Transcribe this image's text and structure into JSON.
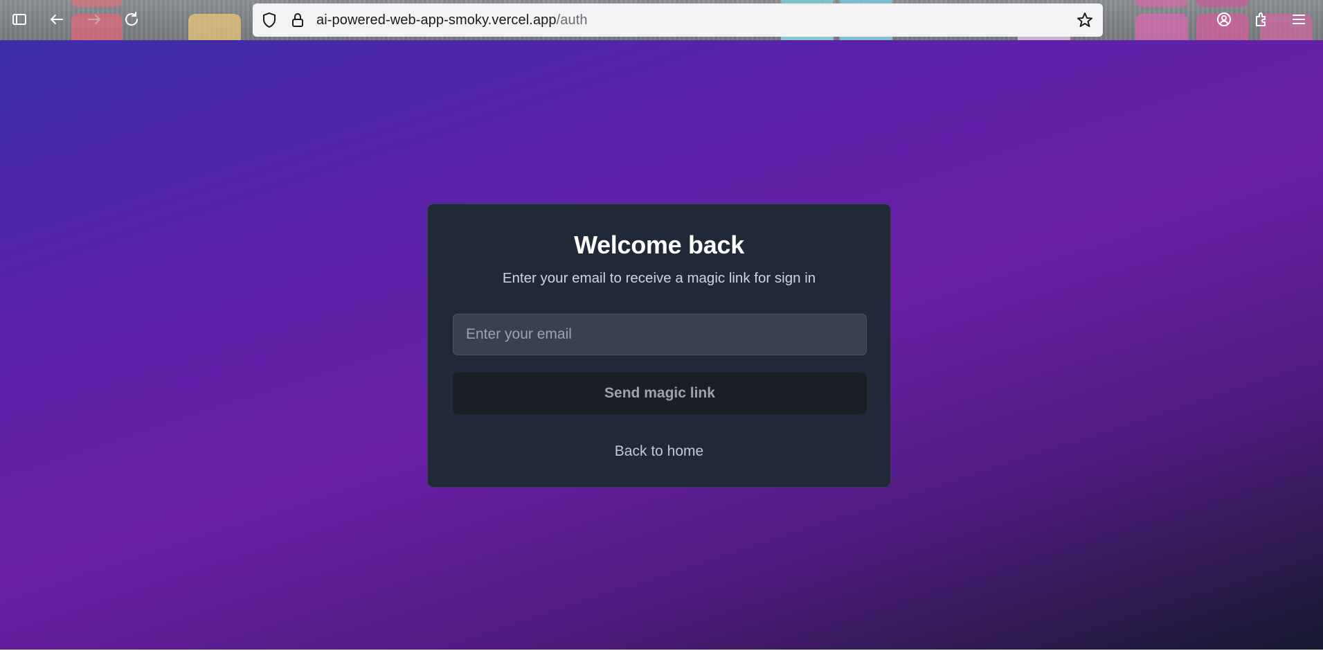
{
  "browser": {
    "url_host": "ai-powered-web-app-smoky.vercel.app",
    "url_path": "/auth",
    "icons": {
      "sidebar": "sidebar-icon",
      "back": "back-arrow-icon",
      "forward": "forward-arrow-icon",
      "reload": "reload-icon",
      "shield": "shield-icon",
      "lock": "lock-icon",
      "bookmark": "star-icon",
      "account": "account-icon",
      "extensions": "extensions-icon",
      "menu": "hamburger-menu-icon"
    }
  },
  "auth": {
    "title": "Welcome back",
    "subtitle": "Enter your email to receive a magic link for sign in",
    "email_placeholder": "Enter your email",
    "email_value": "",
    "submit_label": "Send magic link",
    "back_label": "Back to home"
  },
  "colors": {
    "card_bg": "#1f2937",
    "input_bg": "#374151",
    "button_bg": "#1a1f26",
    "gradient_start": "#3b2ea6",
    "gradient_mid": "#6a1fa6",
    "gradient_end": "#161a2e"
  }
}
